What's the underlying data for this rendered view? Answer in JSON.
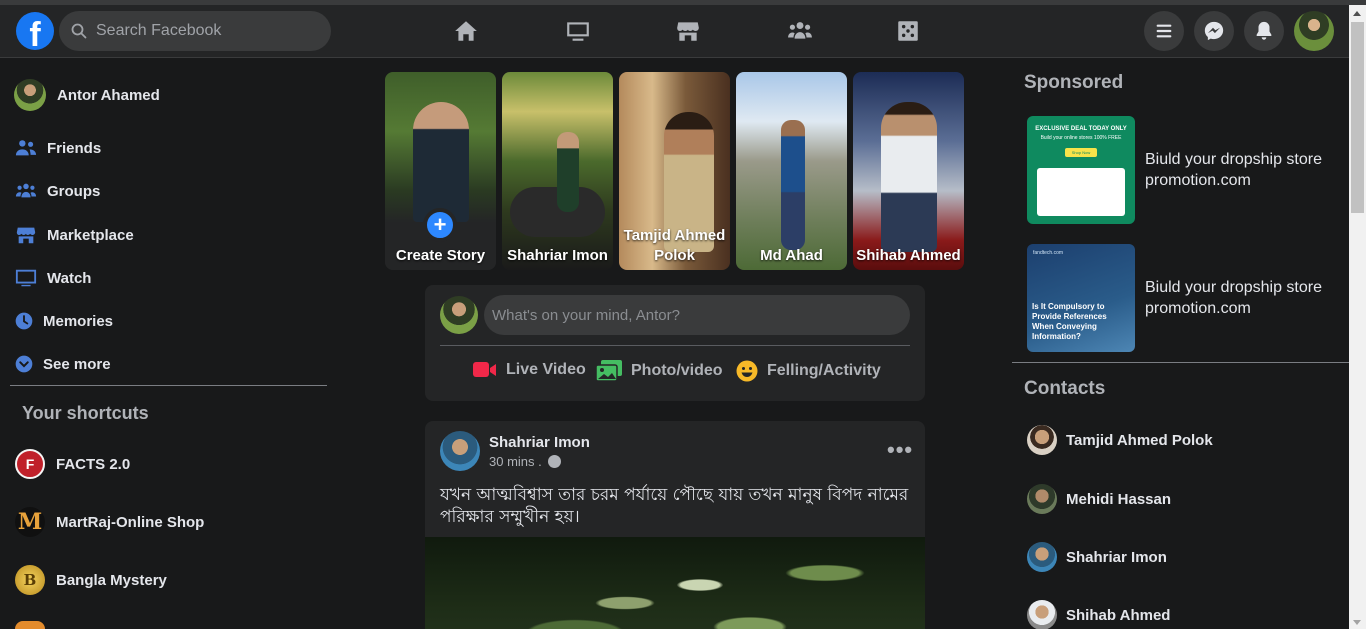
{
  "header": {
    "logo": "f",
    "search_placeholder": "Search Facebook",
    "nav_icons": [
      "home-icon",
      "watch-icon",
      "marketplace-icon",
      "groups-icon",
      "gaming-icon"
    ],
    "right_icons": [
      "menu-icon",
      "messenger-icon",
      "notifications-icon"
    ]
  },
  "sidebar": {
    "profile_name": "Antor Ahamed",
    "items": [
      {
        "label": "Friends",
        "icon": "friends-icon"
      },
      {
        "label": "Groups",
        "icon": "groups-icon"
      },
      {
        "label": "Marketplace",
        "icon": "marketplace-icon"
      },
      {
        "label": "Watch",
        "icon": "watch-icon"
      },
      {
        "label": "Memories",
        "icon": "memories-icon"
      },
      {
        "label": "See more",
        "icon": "chevron-down-icon"
      }
    ],
    "shortcuts_title": "Your shortcuts",
    "shortcuts": [
      {
        "label": "FACTS 2.0",
        "icon_text": "F"
      },
      {
        "label": "MartRaj-Online Shop",
        "icon_text": "M"
      },
      {
        "label": "Bangla Mystery",
        "icon_text": "B"
      }
    ]
  },
  "stories": {
    "create_label": "Create Story",
    "items": [
      {
        "name": "Shahriar Imon"
      },
      {
        "name": "Tamjid Ahmed Polok"
      },
      {
        "name": "Md Ahad"
      },
      {
        "name": "Shihab Ahmed"
      }
    ]
  },
  "composer": {
    "placeholder": "What's on your mind, Antor?",
    "actions": [
      {
        "label": "Live Video",
        "icon": "live-video-icon",
        "color": "#f02849"
      },
      {
        "label": "Photo/video",
        "icon": "photo-icon",
        "color": "#45bd62"
      },
      {
        "label": "Felling/Activity",
        "icon": "emoji-icon",
        "color": "#f7b928"
      }
    ]
  },
  "post": {
    "author": "Shahriar Imon",
    "time": "30 mins .",
    "text": "যখন আত্মবিশ্বাস তার চরম পর্যায়ে পৌছে যায় তখন মানুষ বিপদ নামের পরিক্ষার সম্মুখীন হয়।",
    "more": "•••"
  },
  "sponsored": {
    "title": "Sponsored",
    "ads": [
      {
        "text_line1": "Biuld your dropship store",
        "text_line2": "promotion.com",
        "img_text": "EXCLUSIVE DEAL TODAY ONLY",
        "img_sub": "Build your online stores 100% FREE",
        "img_btn": "Shop Now"
      },
      {
        "text_line1": "Biuld your dropship store",
        "text_line2": "promotion.com",
        "img_text": "Is It Compulsory to Provide References When Conveying Information?",
        "img_brand": "fandtech.com"
      }
    ]
  },
  "contacts": {
    "title": "Contacts",
    "items": [
      {
        "name": "Tamjid Ahmed Polok"
      },
      {
        "name": "Mehidi Hassan"
      },
      {
        "name": "Shahriar Imon"
      },
      {
        "name": "Shihab Ahmed"
      }
    ]
  },
  "colors": {
    "background": "#18191a",
    "surface": "#242526",
    "accent": "#1877f2"
  }
}
